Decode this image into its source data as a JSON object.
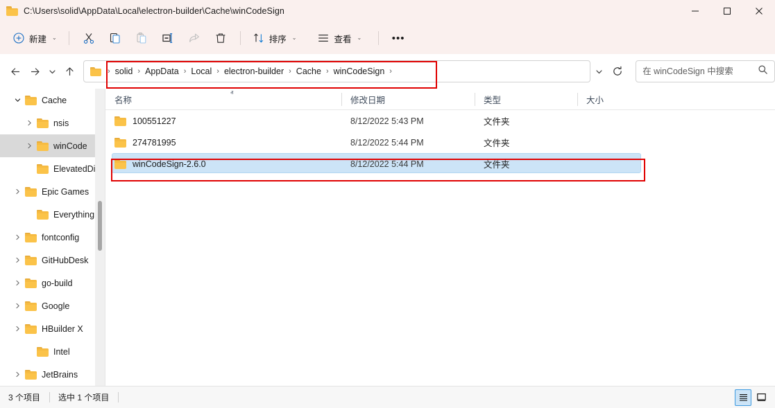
{
  "window": {
    "title": "C:\\Users\\solid\\AppData\\Local\\electron-builder\\Cache\\winCodeSign",
    "minimize_label": "—",
    "maximize_label": "□",
    "close_label": "✕"
  },
  "toolbar": {
    "new_label": "新建",
    "cut_label": "",
    "copy_label": "",
    "paste_label": "",
    "rename_label": "",
    "share_label": "",
    "delete_label": "",
    "sort_label": "排序",
    "view_label": "查看",
    "more_label": "•••",
    "caret": "⌄"
  },
  "address": {
    "back_label": "←",
    "forward_label": "→",
    "recent_label": "⌄",
    "up_label": "↑",
    "crumb_sep": "›",
    "crumbs": [
      {
        "label": "solid"
      },
      {
        "label": "AppData"
      },
      {
        "label": "Local"
      },
      {
        "label": "electron-builder"
      },
      {
        "label": "Cache"
      },
      {
        "label": "winCodeSign"
      }
    ],
    "dropdown_label": "⌄",
    "refresh_label": "↻"
  },
  "search": {
    "placeholder": "在 winCodeSign 中搜索",
    "value": "",
    "icon": "search-icon"
  },
  "sidebar": {
    "items": [
      {
        "label": "Cache",
        "indent": 0,
        "chevron": "expanded",
        "selected": false
      },
      {
        "label": "nsis",
        "indent": 1,
        "chevron": "collapsed",
        "selected": false
      },
      {
        "label": "winCode",
        "indent": 1,
        "chevron": "collapsed",
        "selected": true
      },
      {
        "label": "ElevatedDia",
        "indent": 1,
        "chevron": "none",
        "selected": false
      },
      {
        "label": "Epic Games",
        "indent": 0,
        "chevron": "collapsed",
        "selected": false
      },
      {
        "label": "Everything",
        "indent": 1,
        "chevron": "none",
        "selected": false
      },
      {
        "label": "fontconfig",
        "indent": 0,
        "chevron": "collapsed",
        "selected": false
      },
      {
        "label": "GitHubDesk",
        "indent": 0,
        "chevron": "collapsed",
        "selected": false
      },
      {
        "label": "go-build",
        "indent": 0,
        "chevron": "collapsed",
        "selected": false
      },
      {
        "label": "Google",
        "indent": 0,
        "chevron": "collapsed",
        "selected": false
      },
      {
        "label": "HBuilder X",
        "indent": 0,
        "chevron": "collapsed",
        "selected": false
      },
      {
        "label": "Intel",
        "indent": 1,
        "chevron": "none",
        "selected": false
      },
      {
        "label": "JetBrains",
        "indent": 0,
        "chevron": "collapsed",
        "selected": false
      }
    ]
  },
  "filelist": {
    "columns": [
      {
        "label": "名称"
      },
      {
        "label": "修改日期"
      },
      {
        "label": "类型"
      },
      {
        "label": "大小"
      }
    ],
    "sort_indicator": "ⱏ",
    "rows": [
      {
        "name": "100551227",
        "modified": "8/12/2022 5:43 PM",
        "type": "文件夹",
        "size": "",
        "selected": false
      },
      {
        "name": "274781995",
        "modified": "8/12/2022 5:44 PM",
        "type": "文件夹",
        "size": "",
        "selected": false
      },
      {
        "name": "winCodeSign-2.6.0",
        "modified": "8/12/2022 5:44 PM",
        "type": "文件夹",
        "size": "",
        "selected": true
      }
    ]
  },
  "statusbar": {
    "item_count": "3 个项目",
    "selection": "选中 1 个项目",
    "details_view": "details-view-icon",
    "large_icons_view": "large-icons-view-icon"
  },
  "colors": {
    "chrome": "#faf0ee",
    "selection": "#cce4f7",
    "annotation": "#e00000",
    "folder": "#fbc349",
    "accent": "#0a84d8"
  }
}
